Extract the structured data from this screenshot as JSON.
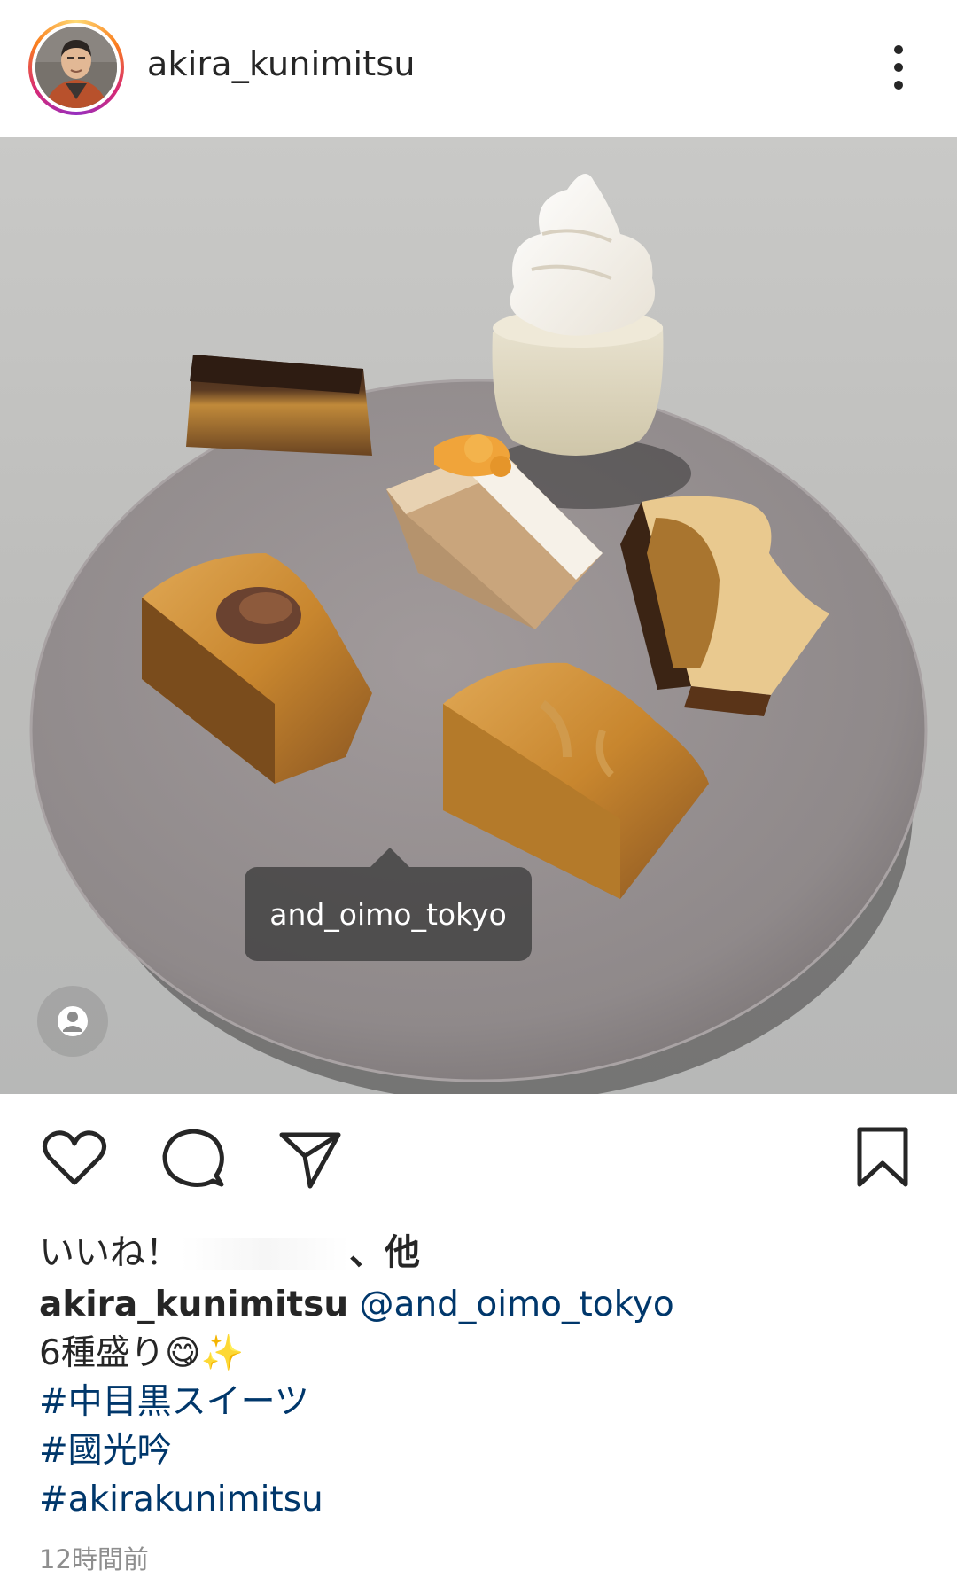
{
  "header": {
    "username": "akira_kunimitsu",
    "avatar_icon": "profile-photo",
    "more_icon": "more-vertical-icon"
  },
  "post": {
    "image_description_icon": "dessert-plate-photo",
    "tag_label": "and_oimo_tokyo",
    "user_tag_icon": "user-tag-icon"
  },
  "actions": {
    "like_icon": "heart-icon",
    "comment_icon": "comment-icon",
    "share_icon": "send-icon",
    "save_icon": "bookmark-icon"
  },
  "likes": {
    "prefix": "いいね！",
    "suffix": "、他"
  },
  "caption": {
    "author": "akira_kunimitsu",
    "mention": "@and_oimo_tokyo",
    "text": "6種盛り😋✨",
    "hashtags": [
      "#中目黒スイーツ",
      "#國光吟",
      "#akirakunimitsu"
    ]
  },
  "timestamp": "12時間前",
  "colors": {
    "link": "#00376b",
    "text": "#262626",
    "muted": "#8e8e8e"
  }
}
